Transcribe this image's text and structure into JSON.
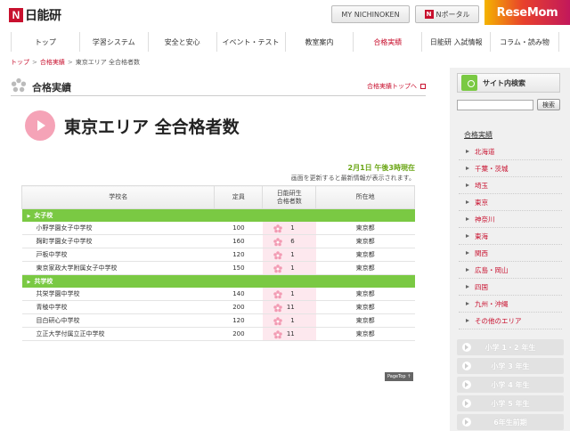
{
  "header": {
    "logo_text": "日能研",
    "logo_mark": "N",
    "my_button": "MY NICHINOKEN",
    "portal_mark": "N",
    "portal_button": "Nポータル",
    "brand_badge": "ReseMom"
  },
  "nav": {
    "items": [
      {
        "label": "トップ",
        "active": false
      },
      {
        "label": "学習システム",
        "active": false
      },
      {
        "label": "安全と安心",
        "active": false
      },
      {
        "label": "イベント・テスト",
        "active": false
      },
      {
        "label": "教室案内",
        "active": false
      },
      {
        "label": "合格実績",
        "active": true
      },
      {
        "label": "日能研 入試情報",
        "active": false
      },
      {
        "label": "コラム・読み物",
        "active": false
      }
    ]
  },
  "breadcrumb": {
    "items": [
      "トップ",
      "合格実績",
      "東京エリア 全合格者数"
    ],
    "separator": ">"
  },
  "section": {
    "title": "合格実績",
    "link": "合格実績トップへ"
  },
  "page": {
    "heading": "東京エリア 全合格者数",
    "update_time": "2月1日 午後3時現在",
    "update_note": "画面を更新すると最新情報が表示されます。"
  },
  "table": {
    "headers": {
      "school": "学校名",
      "capacity": "定員",
      "passers": "日能研生\n合格者数",
      "location": "所在地"
    },
    "groups": [
      {
        "category": "女子校",
        "rows": [
          {
            "school": "小野学園女子中学校",
            "capacity": "100",
            "passers": "1",
            "location": "東京都"
          },
          {
            "school": "麹町学園女子中学校",
            "capacity": "160",
            "passers": "6",
            "location": "東京都"
          },
          {
            "school": "戸板中学校",
            "capacity": "120",
            "passers": "1",
            "location": "東京都"
          },
          {
            "school": "東京家政大学附属女子中学校",
            "capacity": "150",
            "passers": "1",
            "location": "東京都"
          }
        ]
      },
      {
        "category": "共学校",
        "rows": [
          {
            "school": "共栄学園中学校",
            "capacity": "140",
            "passers": "1",
            "location": "東京都"
          },
          {
            "school": "青稜中学校",
            "capacity": "200",
            "passers": "11",
            "location": "東京都"
          },
          {
            "school": "目白研心中学校",
            "capacity": "120",
            "passers": "1",
            "location": "東京都"
          },
          {
            "school": "立正大学付属立正中学校",
            "capacity": "200",
            "passers": "11",
            "location": "東京都"
          }
        ]
      }
    ],
    "pagetop": "PageTop ↑"
  },
  "sidebar": {
    "search_title": "サイト内検索",
    "search_button": "検索",
    "search_placeholder": "",
    "list_heading": "合格実績",
    "areas": [
      "北海道",
      "千葉・茨城",
      "埼玉",
      "東京",
      "神奈川",
      "東海",
      "関西",
      "広島・岡山",
      "四国",
      "九州・沖縄",
      "その他のエリア"
    ],
    "grades": [
      "小学 1・2 年生",
      "小学 3 年生",
      "小学 4 年生",
      "小学 5 年生",
      "6年生前期"
    ]
  },
  "colors": {
    "brand_red": "#c8102e",
    "category_green": "#7ac943",
    "heading_pink": "#f5a3b7",
    "count_bg": "#fde8ee"
  }
}
